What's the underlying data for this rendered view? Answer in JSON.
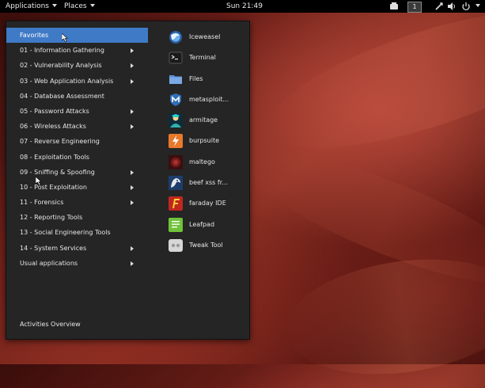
{
  "topbar": {
    "applications_label": "Applications",
    "places_label": "Places",
    "clock": "Sun 21:49",
    "workspace_number": "1"
  },
  "menu": {
    "categories": [
      {
        "label": "Favorites",
        "has_submenu": false,
        "selected": true
      },
      {
        "label": "01 - Information Gathering",
        "has_submenu": true
      },
      {
        "label": "02 - Vulnerability Analysis",
        "has_submenu": true
      },
      {
        "label": "03 - Web Application Analysis",
        "has_submenu": true
      },
      {
        "label": "04 - Database Assessment",
        "has_submenu": false
      },
      {
        "label": "05 - Password Attacks",
        "has_submenu": true
      },
      {
        "label": "06 - Wireless Attacks",
        "has_submenu": true
      },
      {
        "label": "07 - Reverse Engineering",
        "has_submenu": false
      },
      {
        "label": "08 - Exploitation Tools",
        "has_submenu": false
      },
      {
        "label": "09 - Sniffing & Spoofing",
        "has_submenu": true
      },
      {
        "label": "10 - Post Exploitation",
        "has_submenu": true
      },
      {
        "label": "11 - Forensics",
        "has_submenu": true
      },
      {
        "label": "12 - Reporting Tools",
        "has_submenu": false
      },
      {
        "label": "13 - Social Engineering Tools",
        "has_submenu": false
      },
      {
        "label": "14 - System Services",
        "has_submenu": true
      },
      {
        "label": "Usual applications",
        "has_submenu": true
      }
    ],
    "activities_overview": "Activities Overview",
    "favorites": [
      {
        "label": "Iceweasel",
        "icon": "iceweasel-icon"
      },
      {
        "label": "Terminal",
        "icon": "terminal-icon"
      },
      {
        "label": "Files",
        "icon": "files-icon"
      },
      {
        "label": "metasploit...",
        "icon": "metasploit-icon"
      },
      {
        "label": "armitage",
        "icon": "armitage-icon"
      },
      {
        "label": "burpsuite",
        "icon": "burpsuite-icon"
      },
      {
        "label": "maltego",
        "icon": "maltego-icon"
      },
      {
        "label": "beef xss fr...",
        "icon": "beef-icon"
      },
      {
        "label": "faraday IDE",
        "icon": "faraday-icon"
      },
      {
        "label": "Leafpad",
        "icon": "leafpad-icon"
      },
      {
        "label": "Tweak Tool",
        "icon": "tweak-tool-icon"
      }
    ]
  },
  "colors": {
    "selection": "#3f7ac6",
    "panel": "#252525",
    "topbar": "#000000"
  }
}
